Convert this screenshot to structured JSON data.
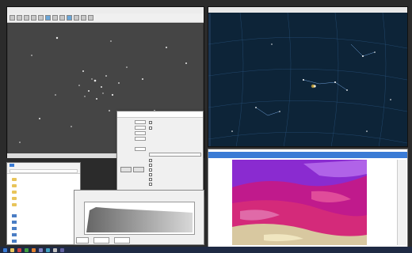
{
  "fits_viewer": {
    "title": "",
    "status": ""
  },
  "dialog": {
    "title": "",
    "rows": [
      "",
      "",
      "",
      "",
      "",
      "",
      "",
      "",
      ""
    ],
    "buttons": [
      "",
      ""
    ]
  },
  "explorer": {
    "tabs": [
      "",
      "",
      ""
    ],
    "tree": [
      "",
      "",
      "",
      "",
      "",
      "",
      "",
      "",
      "",
      ""
    ]
  },
  "histogram": {
    "footer": [
      "",
      "",
      ""
    ]
  },
  "sky": {
    "title": "",
    "info_lines": [
      "",
      "",
      "",
      "",
      "",
      "",
      "",
      "",
      "",
      "",
      "",
      ""
    ]
  },
  "processing": {
    "menu": [
      "",
      "",
      "",
      "",
      ""
    ]
  },
  "taskbar": {
    "tray_text": ""
  },
  "colors": {
    "sky_background": "#0d2438",
    "processed_magenta": "#b0148a",
    "explorer_folder": "#e8c45a",
    "taskbar": "#1f2a44"
  }
}
